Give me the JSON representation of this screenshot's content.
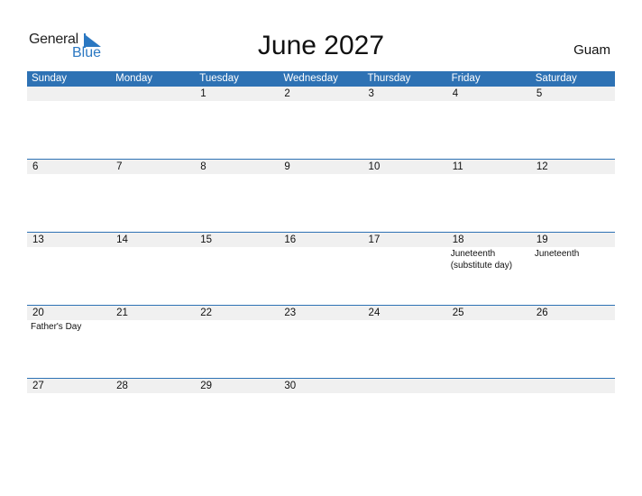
{
  "logo": {
    "general": "General",
    "blue": "Blue"
  },
  "title": "June 2027",
  "country": "Guam",
  "colors": {
    "accent": "#2e72b4",
    "strip": "#f0f0f0"
  },
  "weekdays": [
    "Sunday",
    "Monday",
    "Tuesday",
    "Wednesday",
    "Thursday",
    "Friday",
    "Saturday"
  ],
  "weeks": [
    [
      {
        "day": ""
      },
      {
        "day": ""
      },
      {
        "day": "1"
      },
      {
        "day": "2"
      },
      {
        "day": "3"
      },
      {
        "day": "4"
      },
      {
        "day": "5"
      }
    ],
    [
      {
        "day": "6"
      },
      {
        "day": "7"
      },
      {
        "day": "8"
      },
      {
        "day": "9"
      },
      {
        "day": "10"
      },
      {
        "day": "11"
      },
      {
        "day": "12"
      }
    ],
    [
      {
        "day": "13"
      },
      {
        "day": "14"
      },
      {
        "day": "15"
      },
      {
        "day": "16"
      },
      {
        "day": "17"
      },
      {
        "day": "18",
        "event": "Juneteenth (substitute day)"
      },
      {
        "day": "19",
        "event": "Juneteenth"
      }
    ],
    [
      {
        "day": "20",
        "event": "Father's Day"
      },
      {
        "day": "21"
      },
      {
        "day": "22"
      },
      {
        "day": "23"
      },
      {
        "day": "24"
      },
      {
        "day": "25"
      },
      {
        "day": "26"
      }
    ],
    [
      {
        "day": "27"
      },
      {
        "day": "28"
      },
      {
        "day": "29"
      },
      {
        "day": "30"
      },
      {
        "day": ""
      },
      {
        "day": ""
      },
      {
        "day": ""
      }
    ]
  ]
}
